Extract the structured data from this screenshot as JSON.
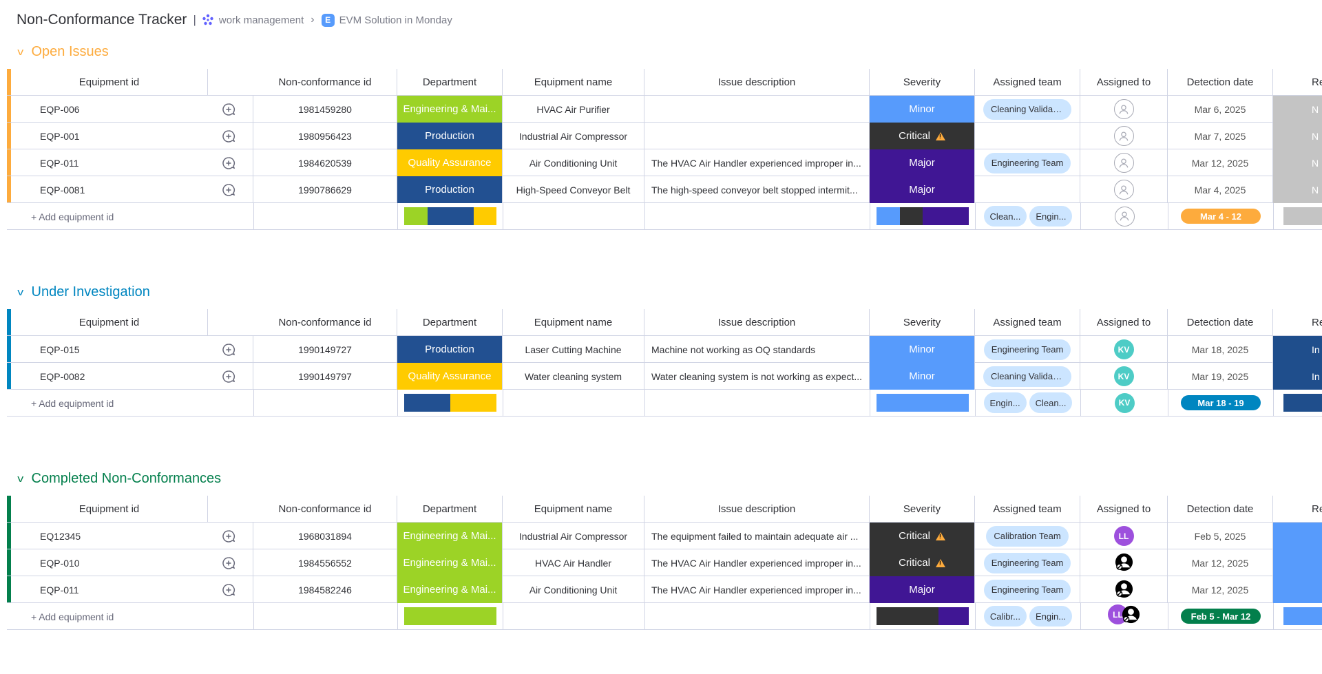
{
  "header": {
    "board_title": "Non-Conformance Tracker",
    "separator": "|",
    "workspace": "work management",
    "chevron": "›",
    "board_badge": "E",
    "board_link": "EVM Solution in Monday"
  },
  "columns": {
    "equipment_id": "Equipment id",
    "nc_id": "Non-conformance id",
    "department": "Department",
    "equipment_name": "Equipment name",
    "issue_description": "Issue description",
    "severity": "Severity",
    "assigned_team": "Assigned team",
    "assigned_to": "Assigned to",
    "detection_date": "Detection date",
    "resolution": "Resc"
  },
  "colors": {
    "engineering": "#9cd326",
    "production": "#225091",
    "quality": "#ffcb00",
    "minor": "#579bfc",
    "critical": "#333333",
    "major": "#401694",
    "open_group": "#fdab3d",
    "investigation_group": "#0086c0",
    "completed_group": "#037f4c",
    "grey_status": "#c4c4c4",
    "blue_status": "#1f4e8c",
    "light_blue_status": "#579bfc"
  },
  "add_label": "+ Add equipment id",
  "groups": [
    {
      "title": "Open Issues",
      "color": "#fdab3d",
      "rows": [
        {
          "eq": "EQP-006",
          "nc": "1981459280",
          "dept": "Engineering & Mai...",
          "dept_color": "#9cd326",
          "name": "HVAC Air Purifier",
          "desc": "",
          "sev": "Minor",
          "sev_color": "#579bfc",
          "warn": false,
          "team": "Cleaning Validati...",
          "assignee": "",
          "date": "Mar 6, 2025",
          "res": "N",
          "res_color": "#c4c4c4"
        },
        {
          "eq": "EQP-001",
          "nc": "1980956423",
          "dept": "Production",
          "dept_color": "#225091",
          "name": "Industrial Air Compressor",
          "desc": "",
          "sev": "Critical",
          "sev_color": "#333333",
          "warn": true,
          "team": "",
          "assignee": "",
          "date": "Mar 7, 2025",
          "res": "N",
          "res_color": "#c4c4c4"
        },
        {
          "eq": "EQP-011",
          "nc": "1984620539",
          "dept": "Quality Assurance",
          "dept_color": "#ffcb00",
          "name": "Air Conditioning Unit",
          "desc": "The HVAC Air Handler experienced improper in...",
          "sev": "Major",
          "sev_color": "#401694",
          "warn": false,
          "team": "Engineering Team",
          "assignee": "",
          "date": "Mar 12, 2025",
          "res": "N",
          "res_color": "#c4c4c4"
        },
        {
          "eq": "EQP-0081",
          "nc": "1990786629",
          "dept": "Production",
          "dept_color": "#225091",
          "name": "High-Speed Conveyor Belt",
          "desc": "The high-speed conveyor belt stopped intermit...",
          "sev": "Major",
          "sev_color": "#401694",
          "warn": false,
          "team": "",
          "assignee": "",
          "date": "Mar 4, 2025",
          "res": "N",
          "res_color": "#c4c4c4"
        }
      ],
      "summary": {
        "dept_bar": [
          {
            "color": "#9cd326",
            "pct": 25
          },
          {
            "color": "#225091",
            "pct": 50
          },
          {
            "color": "#ffcb00",
            "pct": 25
          }
        ],
        "sev_bar": [
          {
            "color": "#579bfc",
            "pct": 25
          },
          {
            "color": "#333333",
            "pct": 25
          },
          {
            "color": "#401694",
            "pct": 50
          }
        ],
        "teams": [
          "Clean...",
          "Engin..."
        ],
        "date_range": "Mar 4 - 12",
        "date_color": "#fdab3d",
        "res_color": "#c4c4c4"
      }
    },
    {
      "title": "Under Investigation",
      "color": "#0086c0",
      "rows": [
        {
          "eq": "EQP-015",
          "nc": "1990149727",
          "dept": "Production",
          "dept_color": "#225091",
          "name": "Laser Cutting Machine",
          "desc": "Machine not working as OQ standards",
          "sev": "Minor",
          "sev_color": "#579bfc",
          "warn": false,
          "team": "Engineering Team",
          "assignee": "KV",
          "date": "Mar 18, 2025",
          "res": "In",
          "res_color": "#1f4e8c"
        },
        {
          "eq": "EQP-0082",
          "nc": "1990149797",
          "dept": "Quality Assurance",
          "dept_color": "#ffcb00",
          "name": "Water cleaning system",
          "desc": "Water cleaning system is not working as expect...",
          "sev": "Minor",
          "sev_color": "#579bfc",
          "warn": false,
          "team": "Cleaning Validati...",
          "assignee": "KV",
          "date": "Mar 19, 2025",
          "res": "In",
          "res_color": "#1f4e8c"
        }
      ],
      "summary": {
        "dept_bar": [
          {
            "color": "#225091",
            "pct": 50
          },
          {
            "color": "#ffcb00",
            "pct": 50
          }
        ],
        "sev_bar": [
          {
            "color": "#579bfc",
            "pct": 100
          }
        ],
        "teams": [
          "Engin...",
          "Clean..."
        ],
        "date_range": "Mar 18 - 19",
        "date_color": "#0086c0",
        "res_color": "#1f4e8c"
      }
    },
    {
      "title": "Completed Non-Conformances",
      "color": "#037f4c",
      "rows": [
        {
          "eq": "EQ12345",
          "nc": "1968031894",
          "dept": "Engineering & Mai...",
          "dept_color": "#9cd326",
          "name": "Industrial Air Compressor",
          "desc": "The equipment failed to maintain adequate air ...",
          "sev": "Critical",
          "sev_color": "#333333",
          "warn": true,
          "team": "Calibration Team",
          "assignee": "LL",
          "date": "Feb 5, 2025",
          "res": "",
          "res_color": "#579bfc"
        },
        {
          "eq": "EQP-010",
          "nc": "1984556552",
          "dept": "Engineering & Mai...",
          "dept_color": "#9cd326",
          "name": "HVAC Air Handler",
          "desc": "The HVAC Air Handler experienced improper in...",
          "sev": "Critical",
          "sev_color": "#333333",
          "warn": true,
          "team": "Engineering Team",
          "assignee": "person",
          "date": "Mar 12, 2025",
          "res": "",
          "res_color": "#579bfc"
        },
        {
          "eq": "EQP-011",
          "nc": "1984582246",
          "dept": "Engineering & Mai...",
          "dept_color": "#9cd326",
          "name": "Air Conditioning Unit",
          "desc": "The HVAC Air Handler experienced improper in...",
          "sev": "Major",
          "sev_color": "#401694",
          "warn": false,
          "team": "Engineering Team",
          "assignee": "person",
          "date": "Mar 12, 2025",
          "res": "",
          "res_color": "#579bfc"
        }
      ],
      "summary": {
        "dept_bar": [
          {
            "color": "#9cd326",
            "pct": 100
          }
        ],
        "sev_bar": [
          {
            "color": "#333333",
            "pct": 67
          },
          {
            "color": "#401694",
            "pct": 33
          }
        ],
        "teams": [
          "Calibr...",
          "Engin..."
        ],
        "date_range": "Feb 5 - Mar 12",
        "date_color": "#037f4c",
        "res_color": "#579bfc"
      }
    }
  ],
  "avatars": {
    "KV": {
      "initials": "KV",
      "color": "#4eccc6"
    },
    "LL": {
      "initials": "LL",
      "color": "#9d50dd"
    }
  },
  "icons": {
    "workspace": "workspace-icon",
    "update": "add-update-icon",
    "empty_person": "empty-person-icon",
    "warning": "warning-icon",
    "collapse": "chevron-down-icon"
  }
}
